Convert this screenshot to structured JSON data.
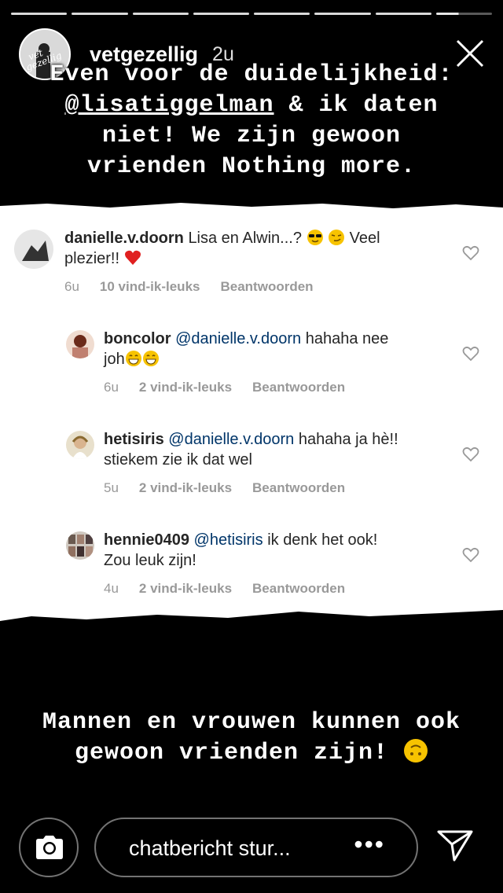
{
  "story": {
    "username": "vetgezellig",
    "time": "2u",
    "avatar_text": "vet gezellig",
    "top_text_lines": [
      "Even voor de duidelijkheid:",
      "@lisatiggelman & ik daten",
      "niet! We zijn gewoon",
      "vrienden Nothing more."
    ],
    "top_mention": "@lisatiggelman",
    "bottom_text_lines": [
      "Mannen en vrouwen kunnen ook",
      "gewoon vrienden zijn!"
    ],
    "bottom_emoji": "upside-down-face-emoji"
  },
  "comments": [
    {
      "user": "danielle.v.doorn",
      "text_line1": "Lisa en Alwin...?",
      "emoji_after_line1": [
        "sunglasses-emoji",
        "smirk-emoji"
      ],
      "text_line1_end": "Veel",
      "text_line2": "plezier!!",
      "emoji_after_line2": [
        "red-heart-emoji"
      ],
      "time": "6u",
      "likes": "10 vind-ik-leuks",
      "reply": "Beantwoorden"
    },
    {
      "user": "boncolor",
      "mention": "@danielle.v.doorn",
      "text_line1": "hahaha nee",
      "text_line2": "joh",
      "emoji_after_line2": [
        "grin-emoji",
        "grin-emoji"
      ],
      "time": "6u",
      "likes": "2 vind-ik-leuks",
      "reply": "Beantwoorden"
    },
    {
      "user": "hetisiris",
      "mention": "@danielle.v.doorn",
      "text_line1": "hahaha ja hè!!",
      "text_line2": "stiekem zie ik dat wel",
      "time": "5u",
      "likes": "2 vind-ik-leuks",
      "reply": "Beantwoorden"
    },
    {
      "user": "hennie0409",
      "mention": "@hetisiris",
      "text_line1": "ik denk het ook!",
      "text_line2": "Zou leuk zijn!",
      "time": "4u",
      "likes": "2 vind-ik-leuks",
      "reply": "Beantwoorden"
    }
  ],
  "composer": {
    "placeholder": "chatbericht stur...",
    "more_icon": "more-dots-icon",
    "camera_icon": "camera-icon",
    "send_icon": "send-paper-plane-icon"
  },
  "colors": {
    "background": "#000000",
    "card": "#ffffff",
    "text": "#262626",
    "meta": "#999999",
    "mention": "#003569",
    "heart": "#e0245e"
  }
}
